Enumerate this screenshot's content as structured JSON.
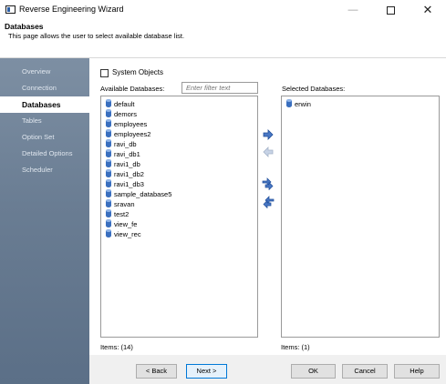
{
  "window": {
    "title": "Reverse Engineering Wizard",
    "minimize": "—",
    "close": "✕"
  },
  "header": {
    "title": "Databases",
    "description": "This page allows the user to select available database list."
  },
  "sidebar": {
    "items": [
      {
        "label": "Overview",
        "active": false
      },
      {
        "label": "Connection",
        "active": false
      },
      {
        "label": "Databases",
        "active": true
      },
      {
        "label": "Tables",
        "active": false
      },
      {
        "label": "Option Set",
        "active": false
      },
      {
        "label": "Detailed Options",
        "active": false
      },
      {
        "label": "Scheduler",
        "active": false
      }
    ]
  },
  "options": {
    "system_objects_label": "System Objects",
    "system_objects_checked": false
  },
  "available": {
    "label": "Available Databases:",
    "filter_placeholder": "Enter filter text",
    "items": [
      "default",
      "demors",
      "employees",
      "employees2",
      "ravi_db",
      "ravi_db1",
      "ravi1_db",
      "ravi1_db2",
      "ravi1_db3",
      "sample_database5",
      "sravan",
      "test2",
      "view_fe",
      "view_rec"
    ],
    "count_label": "Items: (14)"
  },
  "selected": {
    "label": "Selected Databases:",
    "items": [
      "erwin"
    ],
    "count_label": "Items: (1)"
  },
  "buttons": {
    "back": "< Back",
    "next": "Next >",
    "ok": "OK",
    "cancel": "Cancel",
    "help": "Help"
  }
}
